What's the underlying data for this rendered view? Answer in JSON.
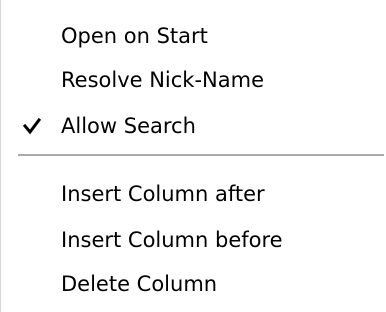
{
  "menu": {
    "group1": [
      {
        "label": "Open on Start",
        "checked": false
      },
      {
        "label": "Resolve Nick-Name",
        "checked": false
      },
      {
        "label": "Allow Search",
        "checked": true
      }
    ],
    "group2": [
      {
        "label": "Insert Column after"
      },
      {
        "label": "Insert Column before"
      },
      {
        "label": "Delete Column"
      }
    ],
    "check_icon": "checkmark-icon"
  }
}
